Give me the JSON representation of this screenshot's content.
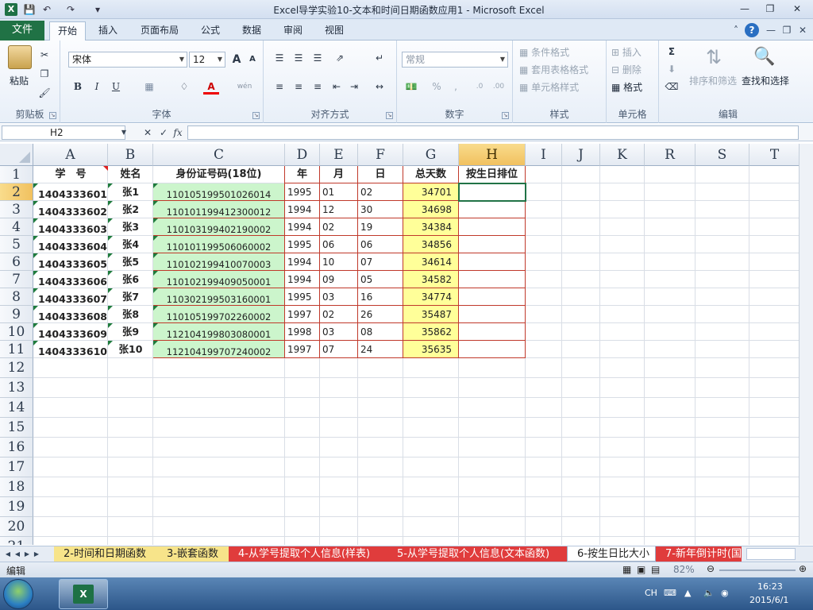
{
  "window": {
    "title": "Excel导学实验10-文本和时间日期函数应用1  -  Microsoft Excel",
    "app_icon": "X",
    "quick_access": [
      "save-icon",
      "undo-icon",
      "redo-icon",
      "customize-icon"
    ],
    "buttons": {
      "minimize": "—",
      "restore": "❐",
      "close": "✕"
    }
  },
  "ribbon_tabs": {
    "file": "文件",
    "tabs": [
      "开始",
      "插入",
      "页面布局",
      "公式",
      "数据",
      "审阅",
      "视图"
    ],
    "active": "开始"
  },
  "ribbon": {
    "clipboard": {
      "label": "剪贴板",
      "paste": "粘贴"
    },
    "font": {
      "label": "字体",
      "font_name": "宋体",
      "font_size": "12",
      "bold": "B",
      "italic": "I",
      "underline": "U",
      "grow": "A",
      "shrink": "A",
      "font_color_glyph": "A",
      "phonetic": "wén"
    },
    "alignment": {
      "label": "对齐方式"
    },
    "number": {
      "label": "数字",
      "format": "常规",
      "percent": "%",
      "comma": ","
    },
    "styles": {
      "label": "样式",
      "conditional": "条件格式",
      "table": "套用表格格式",
      "cell_styles": "单元格样式"
    },
    "cells": {
      "label": "单元格",
      "insert": "插入",
      "delete": "删除",
      "format": "格式"
    },
    "editing": {
      "label": "编辑",
      "sum": "Σ",
      "sort_filter": "排序和筛选",
      "find_select": "查找和选择"
    }
  },
  "formula_bar": {
    "name_box": "H2",
    "cancel": "✕",
    "enter": "✓",
    "fx": "fx",
    "value": ""
  },
  "grid": {
    "columns": [
      "A",
      "B",
      "C",
      "D",
      "E",
      "F",
      "G",
      "H",
      "I",
      "J",
      "K",
      "R",
      "S",
      "T"
    ],
    "selected_column": "H",
    "rows": [
      "1",
      "2",
      "3",
      "4",
      "5",
      "6",
      "7",
      "8",
      "9",
      "10",
      "11",
      "12",
      "13",
      "14",
      "15",
      "16",
      "17",
      "18",
      "19",
      "20",
      "21"
    ],
    "selected_row": "2",
    "active_cell": "H2",
    "headers": [
      "学　号",
      "姓名",
      "身份证号码(18位)",
      "年",
      "月",
      "日",
      "总天数",
      "按生日排位"
    ],
    "records": [
      [
        "1404333601",
        "张1",
        "110105199501026014",
        "1995",
        "01",
        "02",
        "34701",
        ""
      ],
      [
        "1404333602",
        "张2",
        "110101199412300012",
        "1994",
        "12",
        "30",
        "34698",
        ""
      ],
      [
        "1404333603",
        "张3",
        "110103199402190002",
        "1994",
        "02",
        "19",
        "34384",
        ""
      ],
      [
        "1404333604",
        "张4",
        "110101199506060002",
        "1995",
        "06",
        "06",
        "34856",
        ""
      ],
      [
        "1404333605",
        "张5",
        "110102199410070003",
        "1994",
        "10",
        "07",
        "34614",
        ""
      ],
      [
        "1404333606",
        "张6",
        "110102199409050001",
        "1994",
        "09",
        "05",
        "34582",
        ""
      ],
      [
        "1404333607",
        "张7",
        "110302199503160001",
        "1995",
        "03",
        "16",
        "34774",
        ""
      ],
      [
        "1404333608",
        "张8",
        "110105199702260002",
        "1997",
        "02",
        "26",
        "35487",
        ""
      ],
      [
        "1404333609",
        "张9",
        "112104199803080001",
        "1998",
        "03",
        "08",
        "35862",
        ""
      ],
      [
        "1404333610",
        "张10",
        "112104199707240002",
        "1997",
        "07",
        "24",
        "35635",
        ""
      ]
    ],
    "colors": {
      "id_fill": "#ccf5cc",
      "days_fill": "#ffff99",
      "border": "#c0392b",
      "selection": "#217346"
    }
  },
  "sheet_tabs": {
    "tabs": [
      "2-时间和日期函数",
      "3-嵌套函数",
      "4-从学号提取个人信息(样表)",
      "5-从学号提取个人信息(文本函数)",
      "6-按生日比大小",
      "7-新年倒计时(国"
    ],
    "active": "6-按生日比大小",
    "colors": {
      "yellow": "#f7e48a",
      "red": "#e03c3c",
      "active": "#ffffff"
    }
  },
  "status_bar": {
    "mode": "编辑",
    "zoom": "82%"
  },
  "taskbar": {
    "lang": "CH",
    "time": "16:23",
    "date": "2015/6/1"
  }
}
